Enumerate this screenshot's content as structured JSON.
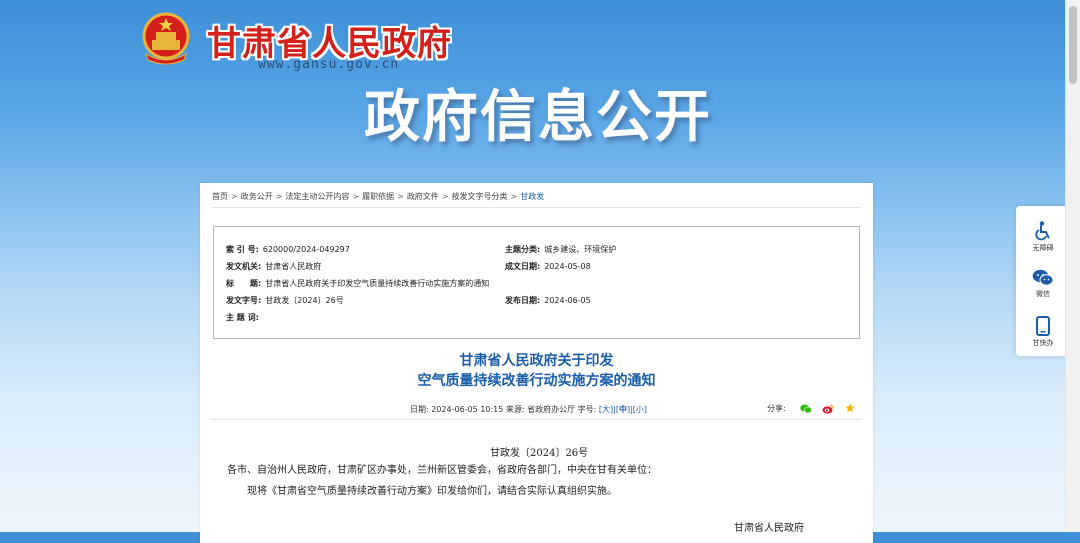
{
  "header": {
    "site_name": "甘肃省人民政府",
    "site_url": "www.gansu.gov.cn",
    "banner_title": "政府信息公开"
  },
  "breadcrumb": {
    "items": [
      "首页",
      "政务公开",
      "法定主动公开内容",
      "履职依据",
      "政府文件",
      "按发文字号分类",
      "甘政发"
    ],
    "separator": ">"
  },
  "meta": {
    "index_label": "索 引 号:",
    "index_value": "620000/2024-049297",
    "topic_label": "主题分类:",
    "topic_value": "城乡建设、环境保护",
    "issuer_label": "发文机关:",
    "issuer_value": "甘肃省人民政府",
    "date_label": "成文日期:",
    "date_value": "2024-05-08",
    "title_label": "标　　题:",
    "title_value": "甘肃省人民政府关于印发空气质量持续改善行动实施方案的通知",
    "docno_label": "发文字号:",
    "docno_value": "甘政发〔2024〕26号",
    "pubdate_label": "发布日期:",
    "pubdate_value": "2024-06-05",
    "keywords_label": "主 题 词:",
    "keywords_value": ""
  },
  "document": {
    "title_line1": "甘肃省人民政府关于印发",
    "title_line2": "空气质量持续改善行动实施方案的通知",
    "info_date": "日期: 2024-06-05 10:15",
    "info_source": "来源: 省政府办公厅",
    "font_size_label": "字号:",
    "font_large": "大",
    "font_medium": "中",
    "font_small": "小",
    "share_label": "分享:",
    "doc_number": "甘政发〔2024〕26号",
    "recipients": "各市、自治州人民政府，甘肃矿区办事处，兰州新区管委会，省政府各部门，中央在甘有关单位：",
    "body_para": "现将《甘肃省空气质量持续改善行动方案》印发给你们，请结合实际认真组织实施。",
    "signature": "甘肃省人民政府"
  },
  "sidebar": {
    "items": [
      {
        "label": "无障碍",
        "icon": "wheelchair-icon"
      },
      {
        "label": "微信",
        "icon": "wechat-icon"
      },
      {
        "label": "甘快办",
        "icon": "mobile-icon"
      }
    ]
  },
  "colors": {
    "brand_red": "#d4201b",
    "link_blue": "#1a5ea8",
    "wechat_green": "#2dc100",
    "weibo_red": "#e6162d",
    "star_gold": "#f2b600"
  }
}
